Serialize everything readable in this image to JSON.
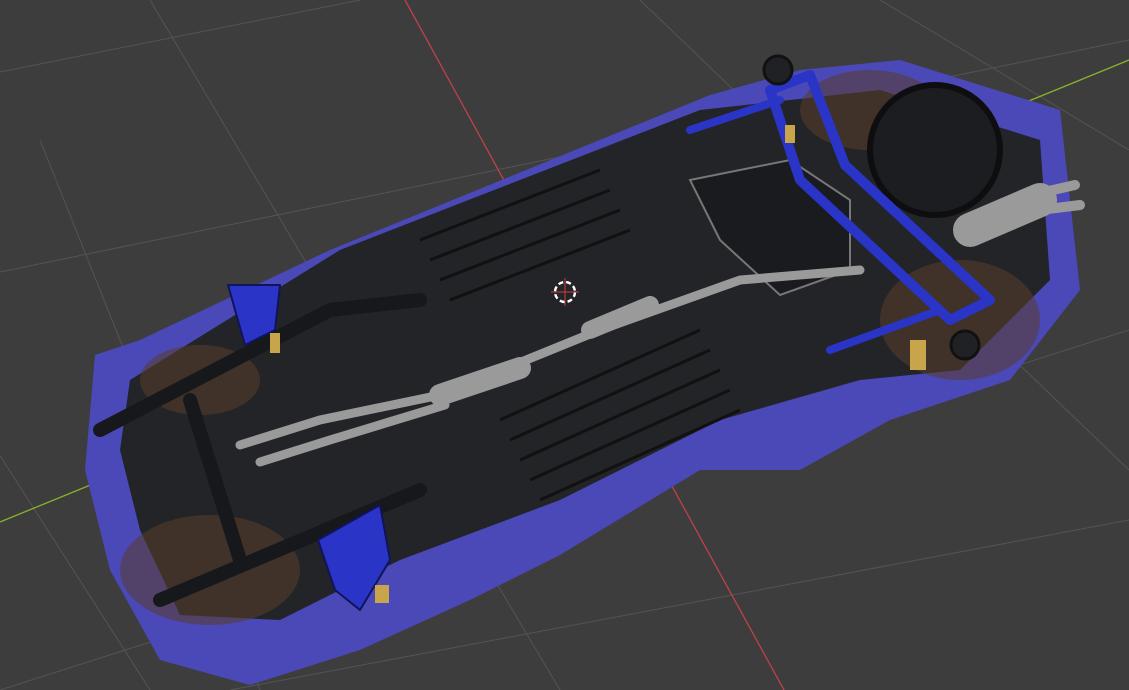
{
  "viewport": {
    "background_color": "#3d3d3d",
    "grid_color": "#545454",
    "x_axis_color": "#c0404a",
    "y_axis_color": "#86b22c",
    "cursor_color": "#ffffff",
    "cursor_accent_color": "#d33a3a"
  },
  "model": {
    "body_color": "#4b48b8",
    "chassis_color": "#222428",
    "rust_color": "#5a3e2a",
    "suspension_color": "#2a35c8",
    "exhaust_color": "#9a9a9a",
    "spring_color": "#c8a44a",
    "icon": "car-underbody-icon"
  },
  "cursor": {
    "icon": "3d-cursor-icon"
  }
}
